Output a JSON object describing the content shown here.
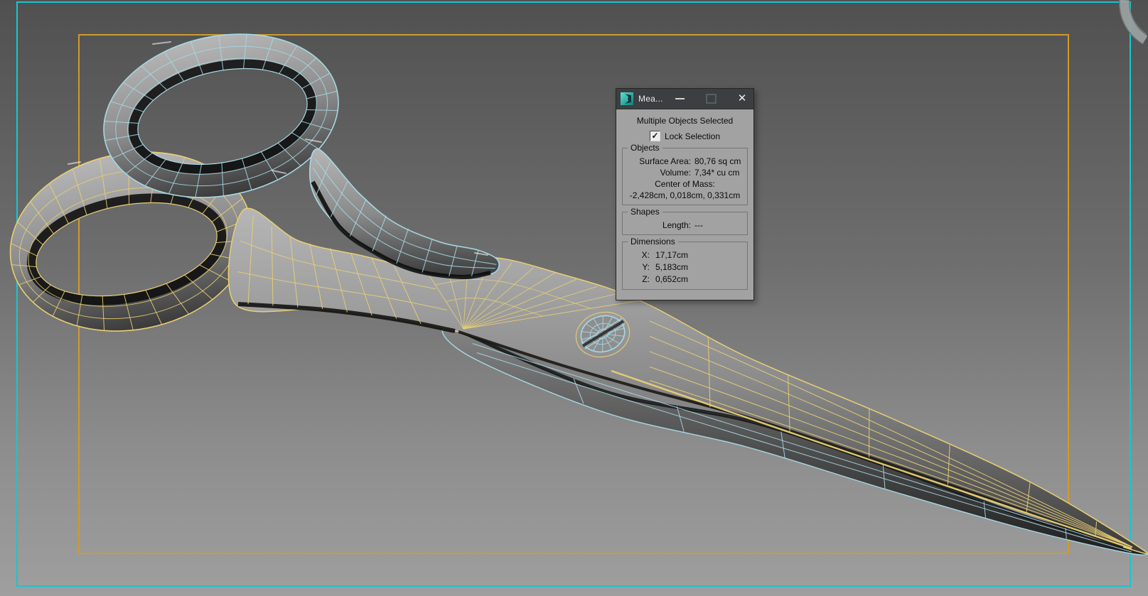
{
  "window": {
    "title": "Mea...",
    "close_glyph": "✕"
  },
  "dialog": {
    "status": "Multiple Objects Selected",
    "lock_selection": {
      "label": "Lock Selection",
      "checked": true,
      "glyph": "✓"
    },
    "groups": {
      "objects": {
        "label": "Objects",
        "rows": [
          {
            "label": "Surface Area:",
            "value": "80,76 sq cm"
          },
          {
            "label": "Volume:",
            "value": "7,34* cu cm"
          },
          {
            "label": "Center of Mass:",
            "value": ""
          },
          {
            "label": "",
            "value": "-2,428cm, 0,018cm, 0,331cm"
          }
        ]
      },
      "shapes": {
        "label": "Shapes",
        "rows": [
          {
            "label": "Length:",
            "value": "---"
          }
        ]
      },
      "dimensions": {
        "label": "Dimensions",
        "rows": [
          {
            "label": "X:",
            "value": "17,17cm"
          },
          {
            "label": "Y:",
            "value": "5,183cm"
          },
          {
            "label": "Z:",
            "value": "0,652cm"
          }
        ]
      }
    }
  },
  "scene": {
    "objects": [
      "scissors-half-cyan",
      "scissors-half-yellow",
      "pivot-screw"
    ],
    "colors": {
      "wire_cyan": "#a7d8e5",
      "wire_yellow": "#e9cf74",
      "frame_cyan": "#17c6d0",
      "frame_yellow": "#cf9a2d",
      "titlebar": "#3b3f41",
      "dialog_bg": "#a2a2a2",
      "logo_teal": "#2db3ab"
    }
  }
}
